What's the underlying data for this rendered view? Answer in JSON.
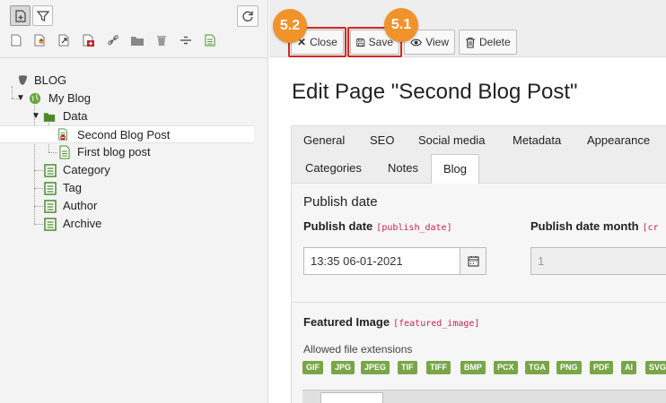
{
  "tree": {
    "root_label": "BLOG",
    "nodes": [
      {
        "label": "My Blog"
      },
      {
        "label": "Data"
      },
      {
        "label": "Second Blog Post"
      },
      {
        "label": "First blog post"
      },
      {
        "label": "Category"
      },
      {
        "label": "Tag"
      },
      {
        "label": "Author"
      },
      {
        "label": "Archive"
      }
    ],
    "toolbar_icons": [
      "new-page-icon",
      "filter-icon",
      "refresh-icon"
    ],
    "doktype_icons": [
      "standard-page-icon",
      "backend-user-section-icon",
      "shortcut-icon",
      "external-link-icon",
      "link-icon",
      "folder-icon",
      "recycler-icon",
      "divider-icon",
      "menu-separator-icon"
    ]
  },
  "header": {
    "close_label": "Close",
    "save_label": "Save",
    "view_label": "View",
    "delete_label": "Delete",
    "badge_close": "5.2",
    "badge_save": "5.1",
    "badge_color": "#f0932b",
    "highlight_color": "#d9251d"
  },
  "main": {
    "title": "Edit Page \"Second Blog Post\"",
    "tabs": [
      {
        "label": "General"
      },
      {
        "label": "SEO"
      },
      {
        "label": "Social media"
      },
      {
        "label": "Metadata"
      },
      {
        "label": "Appearance"
      },
      {
        "label": "Categories"
      },
      {
        "label": "Notes"
      },
      {
        "label": "Blog",
        "active": true
      }
    ],
    "section_title": "Publish date",
    "publish_date": {
      "label": "Publish date",
      "field": "[publish_date]",
      "value": "13:35 06-01-2021"
    },
    "publish_month": {
      "label": "Publish date month",
      "field": "[cr",
      "value": "1"
    },
    "featured_image": {
      "label": "Featured Image",
      "field": "[featured_image]",
      "allowed_text": "Allowed file extensions",
      "extensions": [
        "GIF",
        "JPG",
        "JPEG",
        "TIF",
        "TIFF",
        "BMP",
        "PCX",
        "TGA",
        "PNG",
        "PDF",
        "AI",
        "SVG"
      ],
      "ext_color": "#79a548"
    }
  }
}
